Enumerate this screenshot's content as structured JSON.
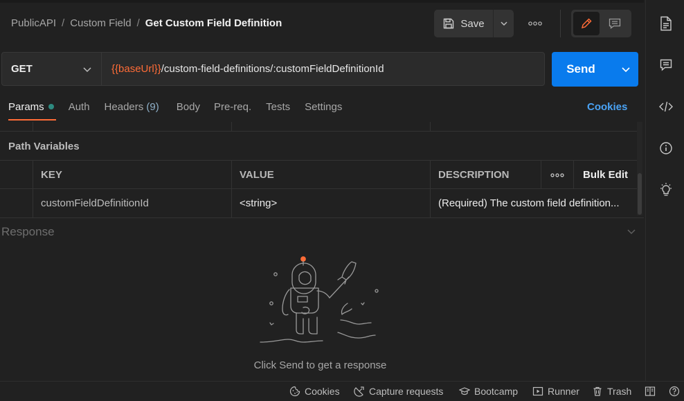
{
  "breadcrumb": {
    "items": [
      "PublicAPI",
      "Custom Field"
    ],
    "separator": "/",
    "current": "Get Custom Field Definition"
  },
  "toolbar": {
    "save_label": "Save"
  },
  "request": {
    "method": "GET",
    "url_variable": "{{baseUrl}}",
    "url_path": "/custom-field-definitions/:customFieldDefinitionId",
    "send_label": "Send"
  },
  "tabs": [
    {
      "label": "Params",
      "active": true,
      "dot": true
    },
    {
      "label": "Auth"
    },
    {
      "label": "Headers",
      "count": "(9)"
    },
    {
      "label": "Body"
    },
    {
      "label": "Pre-req."
    },
    {
      "label": "Tests"
    },
    {
      "label": "Settings"
    }
  ],
  "cookies_link": "Cookies",
  "path_variables": {
    "title": "Path Variables",
    "columns": [
      "KEY",
      "VALUE",
      "DESCRIPTION"
    ],
    "bulk_edit": "Bulk Edit",
    "rows": [
      {
        "key": "customFieldDefinitionId",
        "value": "<string>",
        "description": "(Required) The custom field definition..."
      }
    ]
  },
  "response": {
    "title": "Response",
    "hint": "Click Send to get a response"
  },
  "status_bar": {
    "items": [
      "Cookies",
      "Capture requests",
      "Bootcamp",
      "Runner",
      "Trash"
    ]
  },
  "colors": {
    "accent": "#ff6c37",
    "send": "#097bed",
    "link": "#4aa3f5",
    "params_dot": "#2e8a80"
  }
}
